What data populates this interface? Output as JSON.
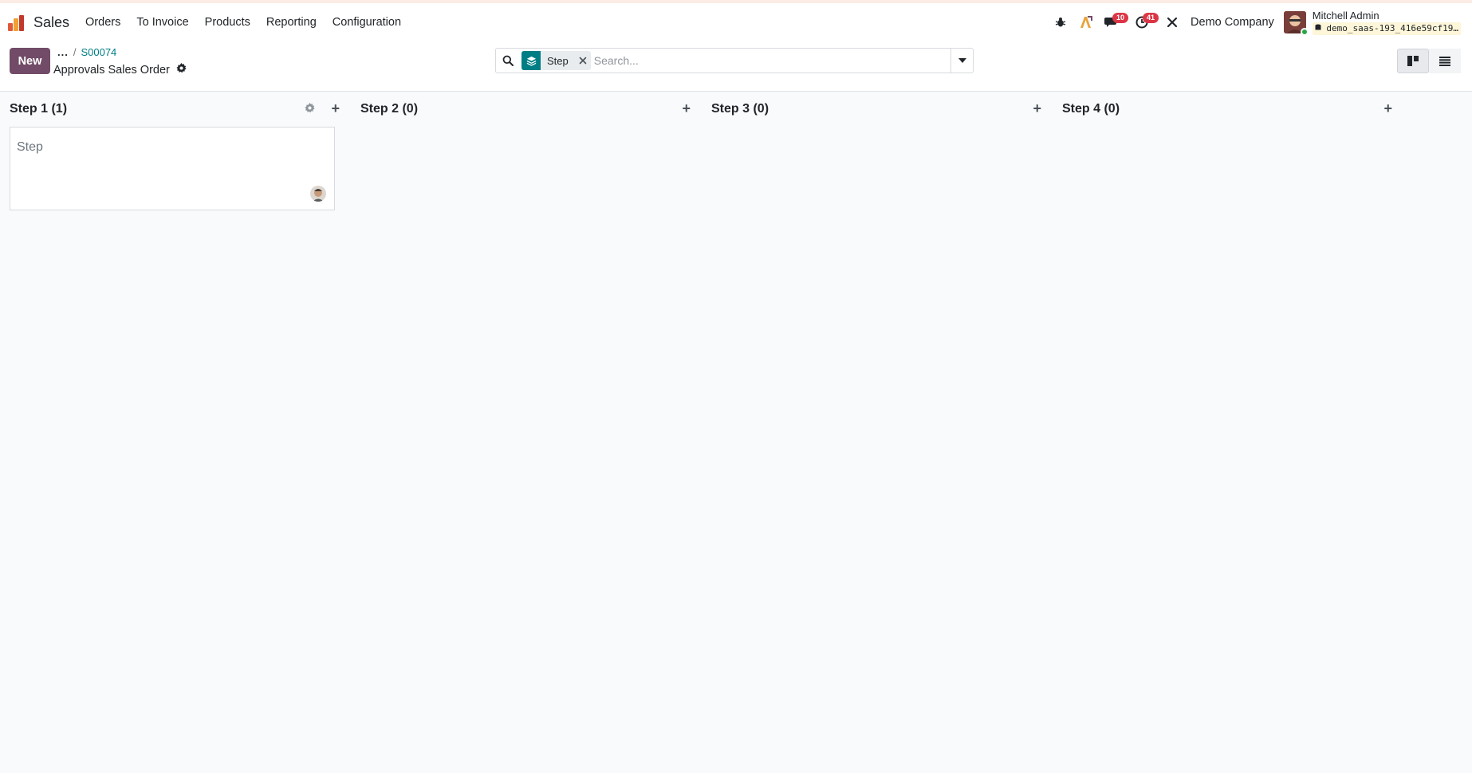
{
  "navbar": {
    "app_name": "Sales",
    "menu": [
      "Orders",
      "To Invoice",
      "Products",
      "Reporting",
      "Configuration"
    ],
    "messages_badge": "10",
    "activities_badge": "41",
    "company": "Demo Company",
    "user_name": "Mitchell Admin",
    "db_name": "demo_saas-193_416e59cf19…"
  },
  "control_panel": {
    "new_label": "New",
    "breadcrumb_dots": "...",
    "breadcrumb_sep": "/",
    "breadcrumb_record": "S00074",
    "view_title": "Approvals Sales Order"
  },
  "search": {
    "facet_value": "Step",
    "placeholder": "Search..."
  },
  "kanban": {
    "columns": [
      {
        "title": "Step 1 (1)"
      },
      {
        "title": "Step 2 (0)"
      },
      {
        "title": "Step 3 (0)"
      },
      {
        "title": "Step 4 (0)"
      }
    ],
    "cards": [
      {
        "title": "Step"
      }
    ]
  },
  "colors": {
    "brand": "#714b67",
    "accent": "#017e84"
  }
}
